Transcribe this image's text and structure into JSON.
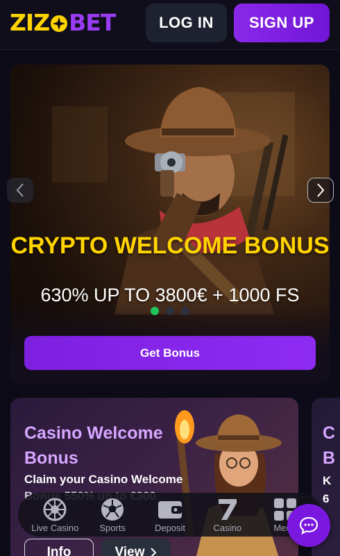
{
  "header": {
    "logo_part1": "ZIZ",
    "logo_part2": "BET",
    "login_label": "LOG IN",
    "signup_label": "SIGN UP"
  },
  "hero": {
    "title": "CRYPTO WELCOME BONUS",
    "subtitle": "630% UP TO 3800€ + 1000 FS",
    "button_label": "Get Bonus",
    "slides_count": 3,
    "active_slide": 1
  },
  "cards": [
    {
      "title": "Casino Welcome Bonus",
      "description": "Claim your Casino Welcome",
      "description_partial": "Bonus 550% up to €300",
      "info_label": "Info",
      "view_label": "View"
    },
    {
      "title_partial": "C B",
      "description_partial": "K 6"
    }
  ],
  "bottom_nav": [
    {
      "label": "Live Casino",
      "icon": "roulette-icon"
    },
    {
      "label": "Sports",
      "icon": "soccer-ball-icon"
    },
    {
      "label": "Deposit",
      "icon": "wallet-icon"
    },
    {
      "label": "Casino",
      "icon": "seven-icon"
    },
    {
      "label": "Menu",
      "icon": "grid-icon"
    }
  ],
  "colors": {
    "brand_yellow": "#ffd400",
    "brand_purple": "#8a28e8",
    "background": "#0d0b17",
    "active_dot": "#21c55d"
  }
}
